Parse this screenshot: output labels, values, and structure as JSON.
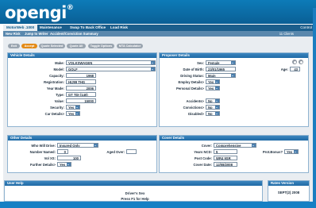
{
  "app": {
    "logo_text": "opengi",
    "logo_mark": "®"
  },
  "menu": {
    "items": [
      {
        "label": "MotorWeb .1000"
      },
      {
        "label": "Maintenance"
      },
      {
        "label": "Swap To Back Office"
      },
      {
        "label": "Load Risk"
      }
    ],
    "control_label": "Control"
  },
  "submenu": {
    "items": [
      {
        "label": "New Risk"
      },
      {
        "label": "Jump to Writer"
      },
      {
        "label": "Accident/Conviction Summary"
      }
    ],
    "clients_count": "11 Clients"
  },
  "toolbar": {
    "buttons": [
      {
        "label": "Exit"
      },
      {
        "label": "Accept"
      },
      {
        "label": "Quote Selected"
      },
      {
        "label": "Quote All"
      },
      {
        "label": "Toggle Options"
      },
      {
        "label": "MTA Calculator"
      }
    ]
  },
  "vehicle": {
    "title": "Vehicle Details",
    "make_label": "Make:",
    "make_value": "VOLKSWAGEN",
    "model_label": "Model:",
    "model_value": "GOLF",
    "capacity_label": "Capacity:",
    "capacity_value": "1968",
    "registration_label": "Registration:",
    "registration_value": "HIJ99 THG",
    "year_label": "Year Made:",
    "year_value": "2006",
    "type_label": "Type:",
    "type_value": "GT TDI (140)",
    "value_label": "Value:",
    "value_value": "15000",
    "security_label": "Security:",
    "security_value": "Yes",
    "car_label": "Car Details>",
    "car_value": "Yes"
  },
  "proposer": {
    "title": "Proposer Details",
    "sex_label": "Sex:",
    "sex_value": "Female",
    "dob_label": "Date of Birth:",
    "dob_value": "23/01/1965",
    "age_label": "Age:",
    "age_value": "43",
    "driving_label": "Driving Status:",
    "driving_value": "Main",
    "employ_label": "Employ Details>",
    "employ_value": "Yes",
    "personal_label": "Personal Details>",
    "personal_value": "Yes",
    "accidents_label": "Accidents>",
    "accidents_value": "No",
    "convictions_label": "Convictions>",
    "convictions_value": "No",
    "disabled_label": "Disabled>",
    "disabled_value": "No"
  },
  "other": {
    "title": "Other Details",
    "drivers_label": "Who Will Drive:",
    "drivers_value": "Insured Only",
    "named_label": "Number Named:",
    "named_value": "0",
    "aged_over_label": "Aged Over:",
    "vol_label": "Vol XS:",
    "vol_value": "100",
    "further_label": "Further Details>",
    "further_value": "Yes"
  },
  "cover": {
    "title": "Cover Details",
    "cover_label": "Cover:",
    "cover_value": "Comprehensive",
    "ncd_label": "Years NCD:",
    "ncd_value": "5",
    "protbonus_label": "Prot.Bonus?",
    "protbonus_value": "Yes",
    "postcode_label": "Post Code:",
    "postcode_value": "WR4 9SR",
    "date_label": "Cover Date:",
    "date_value": "12/08/2008"
  },
  "help": {
    "title": "User Help",
    "line1": "Driver's Sex",
    "line2": "Press F1 for Help"
  },
  "rates": {
    "title": "Rates Version",
    "value": "SEPT(2) 2008"
  },
  "colors": {
    "header_blue": "#0d7bb8",
    "panel_head": "#2f79b4",
    "accent_orange": "#e38a16",
    "content_bg": "#e9edf1"
  }
}
